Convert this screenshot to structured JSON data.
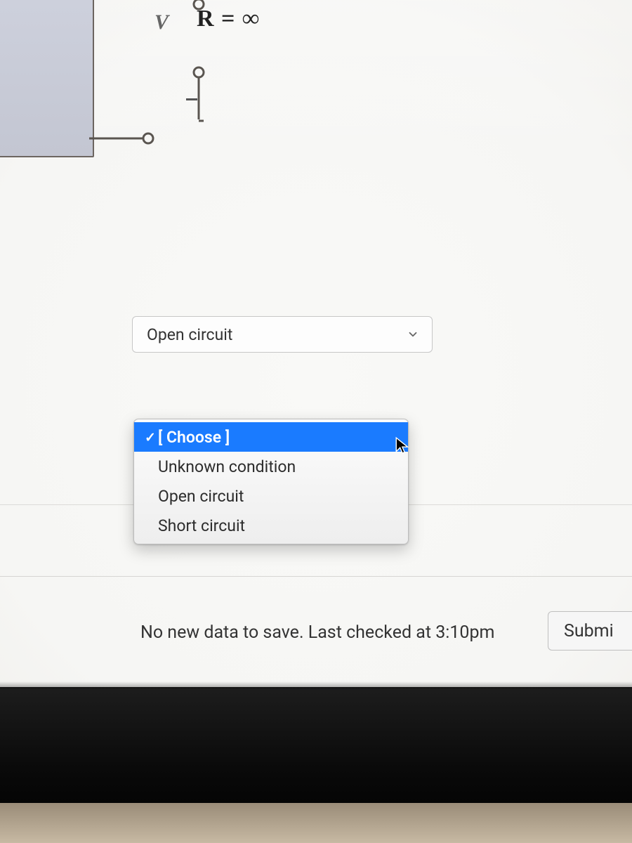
{
  "diagram": {
    "v_label": "V",
    "r_label": "R = ∞"
  },
  "select": {
    "value": "Open circuit"
  },
  "dropdown": {
    "items": [
      {
        "label": "[ Choose ]",
        "checked": true,
        "highlight": true
      },
      {
        "label": "Unknown condition",
        "checked": false,
        "highlight": false
      },
      {
        "label": "Open circuit",
        "checked": false,
        "highlight": false
      },
      {
        "label": "Short circuit",
        "checked": false,
        "highlight": false
      }
    ]
  },
  "status_text": "No new data to save. Last checked at 3:10pm",
  "submit_label": "Submi"
}
